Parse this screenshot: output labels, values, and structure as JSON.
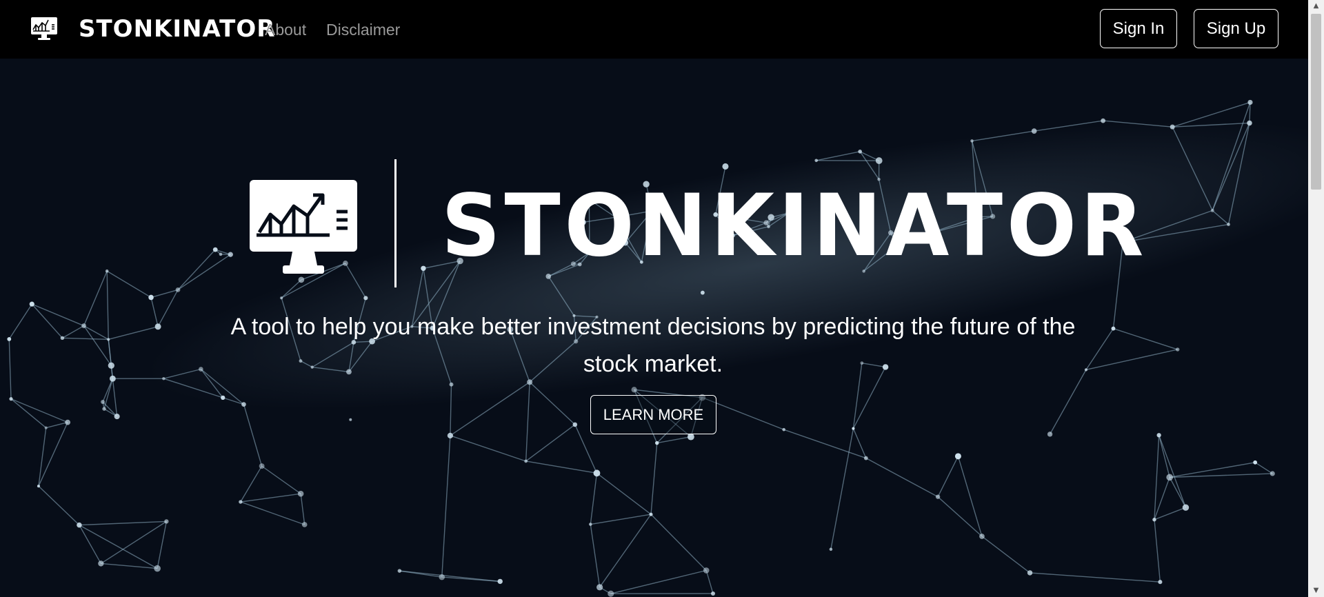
{
  "nav": {
    "brand": "STONKINATOR",
    "links": {
      "about": "About",
      "disclaimer": "Disclaimer"
    },
    "sign_in": "Sign In",
    "sign_up": "Sign Up",
    "logo_icon": "monitor-chart-icon"
  },
  "hero": {
    "title": "STONKINATOR",
    "tagline": "A tool to help you make better investment decisions by predicting the future of the stock market.",
    "cta": "LEARN MORE",
    "logo_icon": "monitor-chart-icon",
    "background": "network-mesh-background"
  },
  "colors": {
    "nav_bg": "#000000",
    "hero_bg": "#070d18",
    "mesh_line": "#8fb0c4",
    "text": "#ffffff",
    "nav_link": "#9a9a9a"
  }
}
